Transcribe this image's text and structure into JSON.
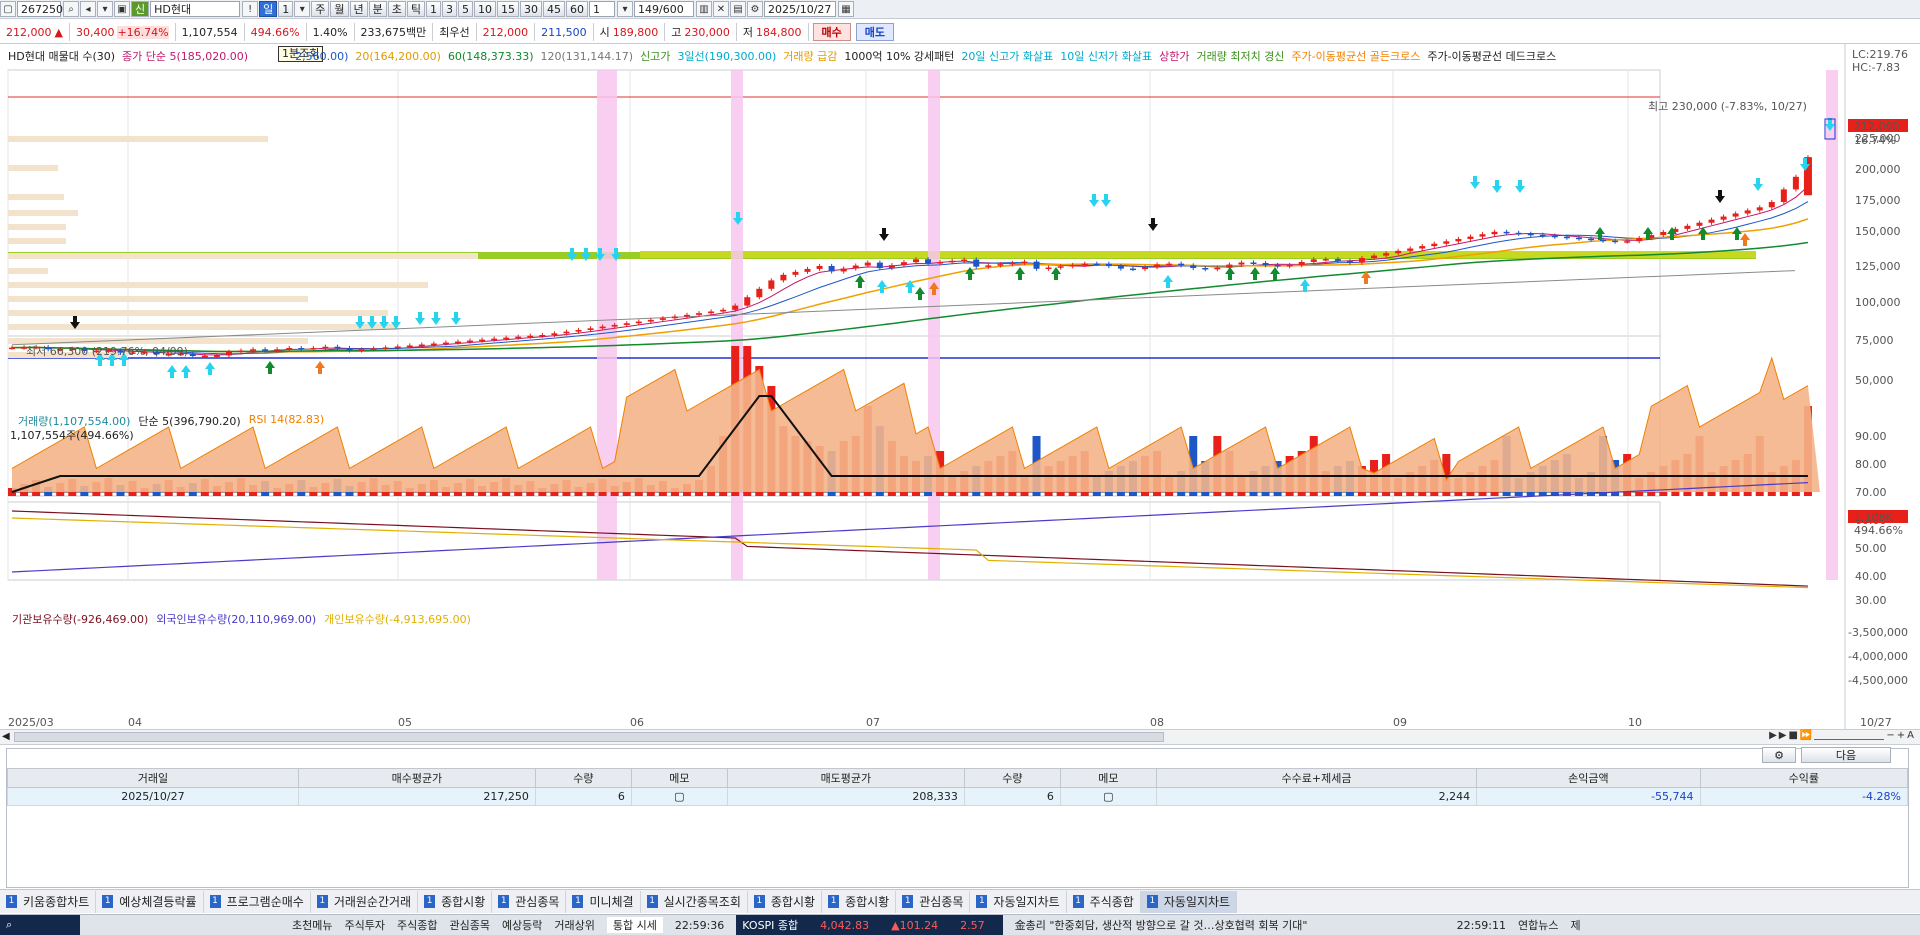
{
  "toolbar1": {
    "code": "267250",
    "name": "HD현대",
    "badge": "신",
    "period_buttons": [
      "일",
      "1",
      "주",
      "월",
      "년",
      "분",
      "초",
      "틱",
      "1",
      "3",
      "5",
      "10",
      "15",
      "30",
      "45",
      "60",
      "1"
    ],
    "count": "149",
    "max_count": "/600",
    "date": "2025/10/27"
  },
  "toolbar2": {
    "price": "212,000",
    "arrow": "▲",
    "change": "30,400",
    "change_pct": "+16.74%",
    "volume": "1,107,554",
    "vol_pct": "494.66%",
    "turnover": "1.40%",
    "amount": "233,675백만",
    "priority": "최우선",
    "bid": "212,000",
    "ask": "211,500",
    "open_label": "시",
    "open": "189,800",
    "high_label": "고",
    "high": "230,000",
    "low_label": "저",
    "low": "184,800",
    "buy_label": "매수",
    "sell_label": "매도"
  },
  "tooltip": "1분조회",
  "legend_price": [
    "HD현대 매물대 수(30)",
    "종가 단순 5(185,020.00)",
    "2,560.00)",
    "20(164,200.00)",
    "60(148,373.33)",
    "120(131,144.17)",
    "신고가",
    "3일선(190,300.00)",
    "거래량 급감",
    "1000억 10% 강세패턴",
    "20일 신고가 화살표",
    "10일 신저가 화살표",
    "상한가",
    "거래량 최저치 경신",
    "주가-이동평균선 골든크로스",
    "주가-이동평균선 데드크로스"
  ],
  "price_axis": [
    "225,000",
    "200,000",
    "175,000",
    "150,000",
    "125,000",
    "100,000",
    "75,000",
    "50,000"
  ],
  "price_right_tags": {
    "lc": "LC:219.76",
    "hc": "HC:-7.83",
    "price": "212,000",
    "pct": "16.74%"
  },
  "annotations": {
    "high": "최고 230,000 (-7.83%, 10/27)",
    "low": "최저 66,300 (219.76%, 04/09)"
  },
  "legend_volume": [
    "거래량(1,107,554.00)",
    "단순 5(396,790.20)",
    "RSI 14(82.83)"
  ],
  "volume_sub": "1,107,554주(494.66%)",
  "vol_axis": [
    "90.00",
    "80.00",
    "70.00",
    "60.00",
    "50.00",
    "40.00",
    "30.00"
  ],
  "vol_tags": {
    "vol": "1,108K",
    "pct": "494.66%"
  },
  "legend_holding": [
    "기관보유수량(-926,469.00)",
    "외국인보유수량(20,110,969.00)",
    "개인보유수량(-4,913,695.00)"
  ],
  "hold_axis": [
    "-3,500,000",
    "-4,000,000",
    "-4,500,000"
  ],
  "date_axis": [
    "2025/03",
    "04",
    "05",
    "06",
    "07",
    "08",
    "09",
    "10",
    "10/27"
  ],
  "colors": {
    "up": "#e8201a",
    "down": "#1d56c6",
    "ma5": "#c2186b",
    "ma10": "#1d56c6",
    "ma20": "#f0a000",
    "ma60": "#128a2e",
    "ma120": "#8a8a8a"
  },
  "table": {
    "headers": [
      "거래일",
      "매수평균가",
      "수량",
      "메모",
      "매도평균가",
      "수량",
      "메모",
      "수수료+제세금",
      "손익금액",
      "수익률"
    ],
    "rows": [
      [
        "2025/10/27",
        "217,250",
        "6",
        "",
        "208,333",
        "6",
        "",
        "2,244",
        "-55,744",
        "-4.28%"
      ]
    ],
    "next_label": "다음"
  },
  "tabs": [
    {
      "n": "1",
      "label": "키움종합차트"
    },
    {
      "n": "1",
      "label": "예상체결등락률"
    },
    {
      "n": "1",
      "label": "프로그램순매수"
    },
    {
      "n": "1",
      "label": "거래원순간거래"
    },
    {
      "n": "1",
      "label": "종합시황"
    },
    {
      "n": "1",
      "label": "관심종목"
    },
    {
      "n": "1",
      "label": "미니체결"
    },
    {
      "n": "1",
      "label": "실시간종목조회"
    },
    {
      "n": "1",
      "label": "종합시황"
    },
    {
      "n": "1",
      "label": "종합시황"
    },
    {
      "n": "1",
      "label": "관심종목"
    },
    {
      "n": "1",
      "label": "자동일지차트"
    },
    {
      "n": "1",
      "label": "주식종합"
    },
    {
      "n": "1",
      "label": "자동일지차트"
    }
  ],
  "status": {
    "menu1": "초천메뉴",
    "menu2": "주식투자",
    "menu3": "주식종합",
    "menu4": "관심종목",
    "menu5": "예상등락",
    "menu6": "거래상위",
    "realtime": "통합 시세",
    "time1": "22:59:36",
    "kospi_label": "KOSPI 종합",
    "kospi": "4,042.83",
    "kospi_chg": "▲101.24",
    "kospi_pct": "2.57",
    "news": "金총리 \"한중회담, 생산적 방향으로 갈 것…상호협력 회복 기대\"",
    "time2": "22:59:11",
    "source": "연합뉴스",
    "end": "제"
  }
}
